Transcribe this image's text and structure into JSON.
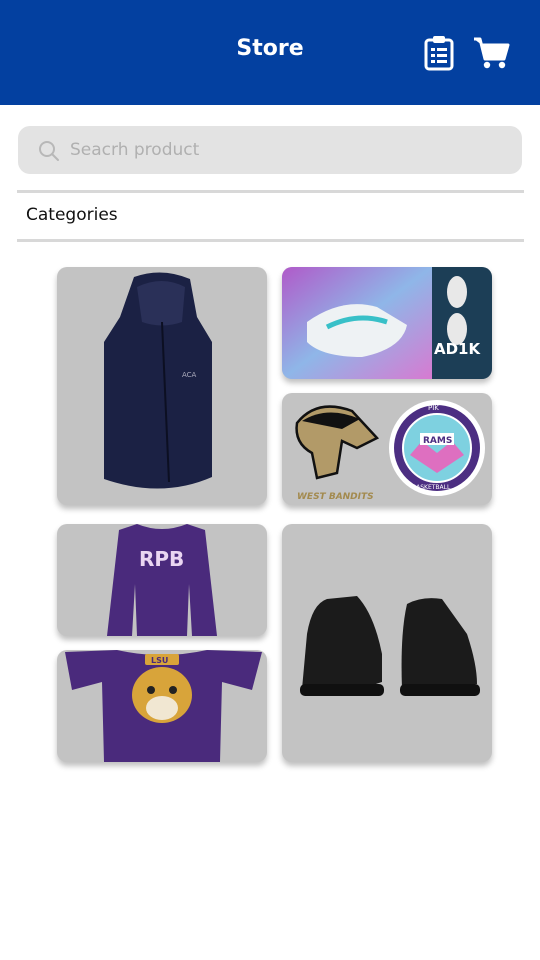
{
  "header": {
    "title": "Store",
    "icons": [
      "clipboard-list-icon",
      "cart-icon"
    ]
  },
  "search": {
    "placeholder": "Seacrh product"
  },
  "categories": {
    "label": "Categories"
  },
  "products": [
    {
      "name": "vest",
      "image": "navy-hooded-vest",
      "logo_text": "ACA"
    },
    {
      "name": "sneaker-banner",
      "image": "sneaker-ad",
      "brand_text": "AD1K"
    },
    {
      "name": "team-logos",
      "image": "west-bandits-and-rams-logos",
      "text_1": "WEST BANDITS",
      "text_2": "PIK",
      "text_3": "RAMS",
      "text_4": "BASKETBALL"
    },
    {
      "name": "longsleeve",
      "image": "purple-longsleeve",
      "logo_text": "RPB"
    },
    {
      "name": "tshirt",
      "image": "purple-tiger-tshirt",
      "logo_text": "LSU"
    },
    {
      "name": "black-sneakers",
      "image": "black-sneakers"
    }
  ],
  "colors": {
    "header": "#0340a0",
    "card": "#c3c3c3",
    "search": "#e3e3e3"
  }
}
